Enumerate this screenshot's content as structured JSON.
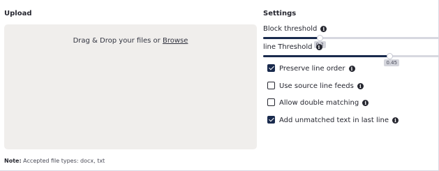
{
  "upload": {
    "heading": "Upload",
    "drop_text": "Drag & Drop your files or ",
    "browse_label": "Browse",
    "note_label": "Note:",
    "note_text": " Accepted file types: docx, txt"
  },
  "settings": {
    "heading": "Settings",
    "block_threshold": {
      "label": "Block threshold",
      "value": "0.2",
      "fraction": 0.32
    },
    "line_threshold": {
      "label": "line Threshold",
      "value": "0.45",
      "fraction": 0.72
    },
    "checkboxes": [
      {
        "label": "Preserve line order",
        "checked": true
      },
      {
        "label": "Use source line feeds",
        "checked": false
      },
      {
        "label": "Allow double matching",
        "checked": false
      },
      {
        "label": "Add unmatched text in last line",
        "checked": true
      }
    ]
  },
  "colors": {
    "accent": "#192a4d",
    "track": "#d7d8e0",
    "dropzone": "#f0eeec"
  },
  "icons": {
    "info": "info-icon"
  }
}
